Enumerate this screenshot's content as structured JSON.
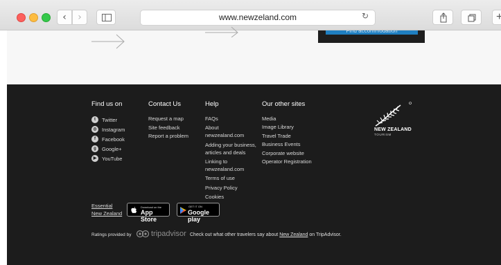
{
  "browser": {
    "url": "www.newzeland.com",
    "back_glyph": "‹",
    "forward_glyph": "›",
    "reload_glyph": "↻",
    "newtab_glyph": "+"
  },
  "page_top": {
    "accommodation_button": "Find accommodation"
  },
  "footer": {
    "find_us": {
      "heading": "Find us on",
      "items": [
        {
          "label": "Twitter",
          "icon": "twitter-icon"
        },
        {
          "label": "Instagram",
          "icon": "instagram-icon"
        },
        {
          "label": "Facebook",
          "icon": "facebook-icon"
        },
        {
          "label": "Google+",
          "icon": "googleplus-icon"
        },
        {
          "label": "YouTube",
          "icon": "youtube-icon"
        }
      ]
    },
    "contact": {
      "heading": "Contact Us",
      "items": [
        "Request a map",
        "Site feedback",
        "Report a problem"
      ]
    },
    "help": {
      "heading": "Help",
      "faqs": "FAQs",
      "about_1": "About",
      "about_2": "newzealand.com",
      "adding_1": "Adding your business,",
      "adding_2": "articles and deals",
      "linking_1": "Linking to",
      "linking_2": "newzealand.com",
      "terms": "Terms of use",
      "privacy": "Privacy Policy",
      "cookies": "Cookies"
    },
    "other_sites": {
      "heading": "Our other sites",
      "items": [
        "Media",
        "Image Library",
        "Travel Trade",
        "Business Events",
        "Corporate website",
        "Operator Registration"
      ]
    },
    "logo": {
      "name": "NEW ZEALAND",
      "sub": "TOURISM"
    },
    "essential_1": "Essential",
    "essential_2": "New Zealand",
    "app_store": {
      "small": "Download on the",
      "big": "App Store"
    },
    "google_play": {
      "small": "GET IT ON",
      "big": "Google play"
    },
    "ratings_label": "Ratings provided by",
    "tripadvisor": "tripadvisor",
    "tripadvisor_check_pre": "Check out what other travelers say about",
    "tripadvisor_check_link": "New Zealand",
    "tripadvisor_check_post": "on TripAdvisor."
  }
}
